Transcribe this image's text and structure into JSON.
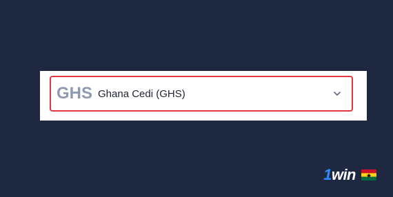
{
  "currency_select": {
    "code": "GHS",
    "name": "Ghana Cedi (GHS)",
    "chevron_icon": "chevron-down-icon",
    "border_color": "#e0363f"
  },
  "brand": {
    "logo_prefix": "1",
    "logo_text": "win",
    "flag_icon": "ghana-flag-icon",
    "accent": "#2f8cff"
  },
  "colors": {
    "background": "#1f2841",
    "panel": "#ffffff",
    "code_text": "#8e9ab0"
  }
}
